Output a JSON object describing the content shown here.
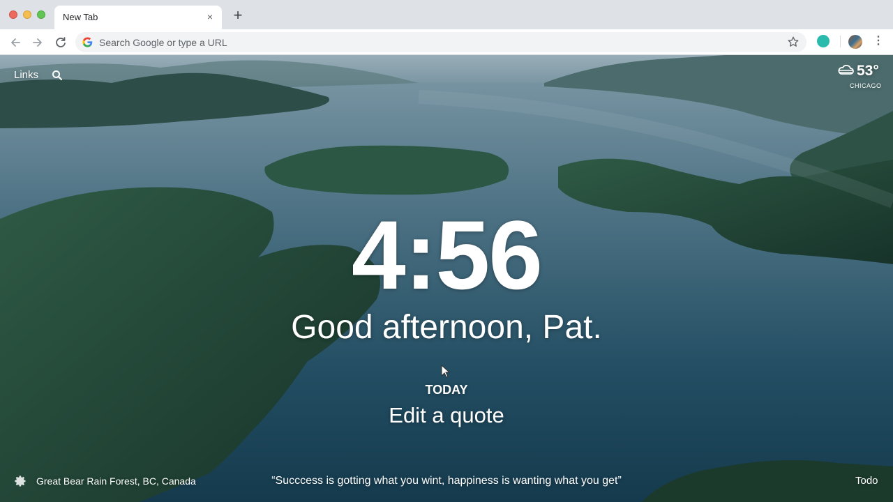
{
  "window": {
    "tab_title": "New Tab",
    "tab_close_glyph": "×",
    "new_tab_glyph": "+"
  },
  "toolbar": {
    "omnibox_placeholder": "Search Google or type a URL",
    "menu_glyph": "⋮"
  },
  "icons": {
    "back": "back-arrow-icon",
    "forward": "forward-arrow-icon",
    "reload": "reload-icon",
    "search_engine": "google-g-icon",
    "bookmark": "star-icon",
    "extension": "extension-dot-icon",
    "profile": "avatar",
    "menu": "kebab-menu-icon",
    "search": "search-icon",
    "weather": "cloudy-weather-icon",
    "settings": "gear-icon"
  },
  "colors": {
    "tabstrip": "#dee1e6",
    "extension_teal": "#2bbbad"
  },
  "momentum": {
    "links_label": "Links",
    "weather": {
      "temperature": "53°",
      "city": "CHICAGO"
    },
    "clock": "4:56",
    "greeting": "Good afternoon, Pat.",
    "today_label": "TODAY",
    "today_text": "Edit a quote",
    "photo_location": "Great Bear Rain Forest, BC, Canada",
    "quote": "“Succcess is gotting what you wint, happiness is wanting what you get”",
    "todo_label": "Todo"
  }
}
